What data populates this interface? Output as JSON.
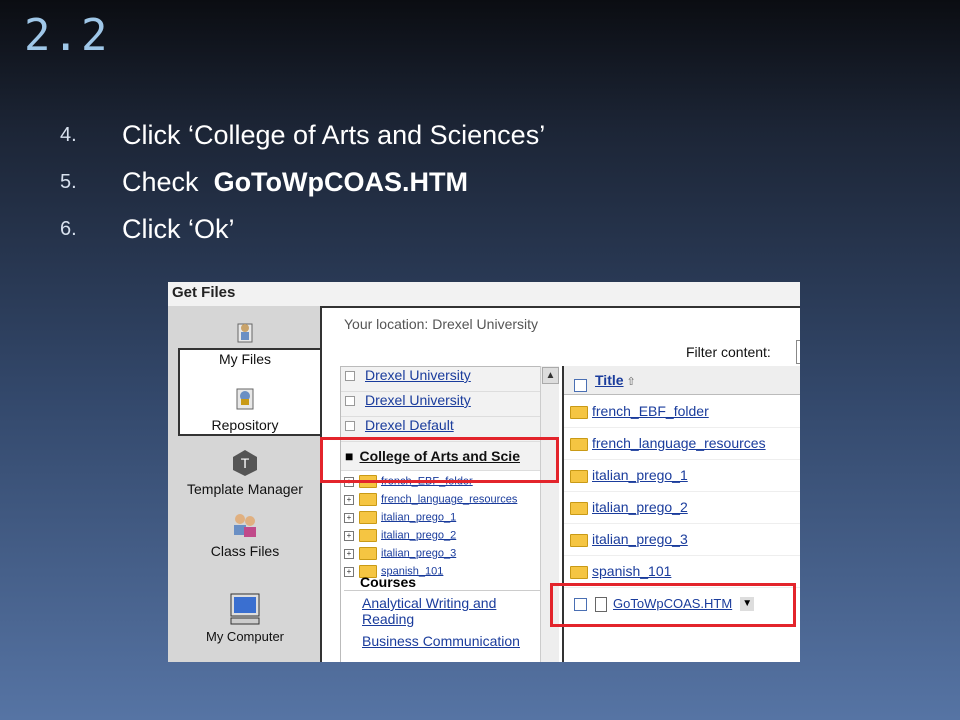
{
  "slide": {
    "title": "2.2",
    "steps": [
      {
        "num": "4.",
        "text": "Click ‘College of Arts and Sciences’"
      },
      {
        "num": "5.",
        "pre": "Check ",
        "bold": "GoToWpCOAS.HTM"
      },
      {
        "num": "6.",
        "text": "Click ‘Ok’"
      }
    ]
  },
  "screenshot": {
    "header": "Get Files",
    "nav": [
      "My Files",
      "Repository",
      "Template Manager",
      "Class Files",
      "My Computer"
    ],
    "location": "Your location: Drexel University",
    "filter_label": "Filter content:",
    "tree": {
      "top": [
        "Drexel University",
        "Drexel University",
        "Drexel Default"
      ],
      "selected": "College of Arts and Scie",
      "children": [
        "french_EBF_folder",
        "french_language_resources",
        "italian_prego_1",
        "italian_prego_2",
        "italian_prego_3",
        "spanish_101"
      ],
      "courses_label": "Courses",
      "courses": [
        "Analytical Writing and Reading",
        "Business Communication"
      ]
    },
    "list": {
      "title_header": "Title",
      "folders": [
        "french_EBF_folder",
        "french_language_resources",
        "italian_prego_1",
        "italian_prego_2",
        "italian_prego_3",
        "spanish_101"
      ],
      "file": "GoToWpCOAS.HTM"
    }
  },
  "highlight_color": "#e3242b"
}
